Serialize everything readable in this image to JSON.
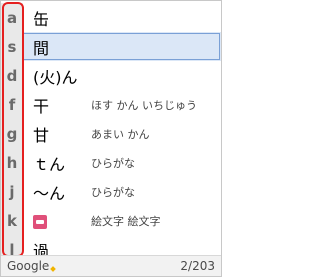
{
  "candidates": [
    {
      "key": "a",
      "text": "缶",
      "desc": ""
    },
    {
      "key": "s",
      "text": "間",
      "desc": ""
    },
    {
      "key": "d",
      "text": "(火)ん",
      "desc": ""
    },
    {
      "key": "f",
      "text": "干",
      "desc": "ほす かん いちじゅう"
    },
    {
      "key": "g",
      "text": "甘",
      "desc": "あまい かん"
    },
    {
      "key": "h",
      "text": "ｔん",
      "desc": "ひらがな"
    },
    {
      "key": "j",
      "text": "～ん",
      "desc": "ひらがな"
    },
    {
      "key": "k",
      "text": "",
      "desc": "絵文字 絵文字",
      "icon": "emoji-icon"
    },
    {
      "key": "l",
      "text": "過...",
      "desc": ""
    }
  ],
  "selected_index": 1,
  "footer": {
    "brand": "Google",
    "count": "2/203"
  },
  "colors": {
    "selected_bg": "#dbe7f7",
    "highlight_border": "#e52020"
  }
}
